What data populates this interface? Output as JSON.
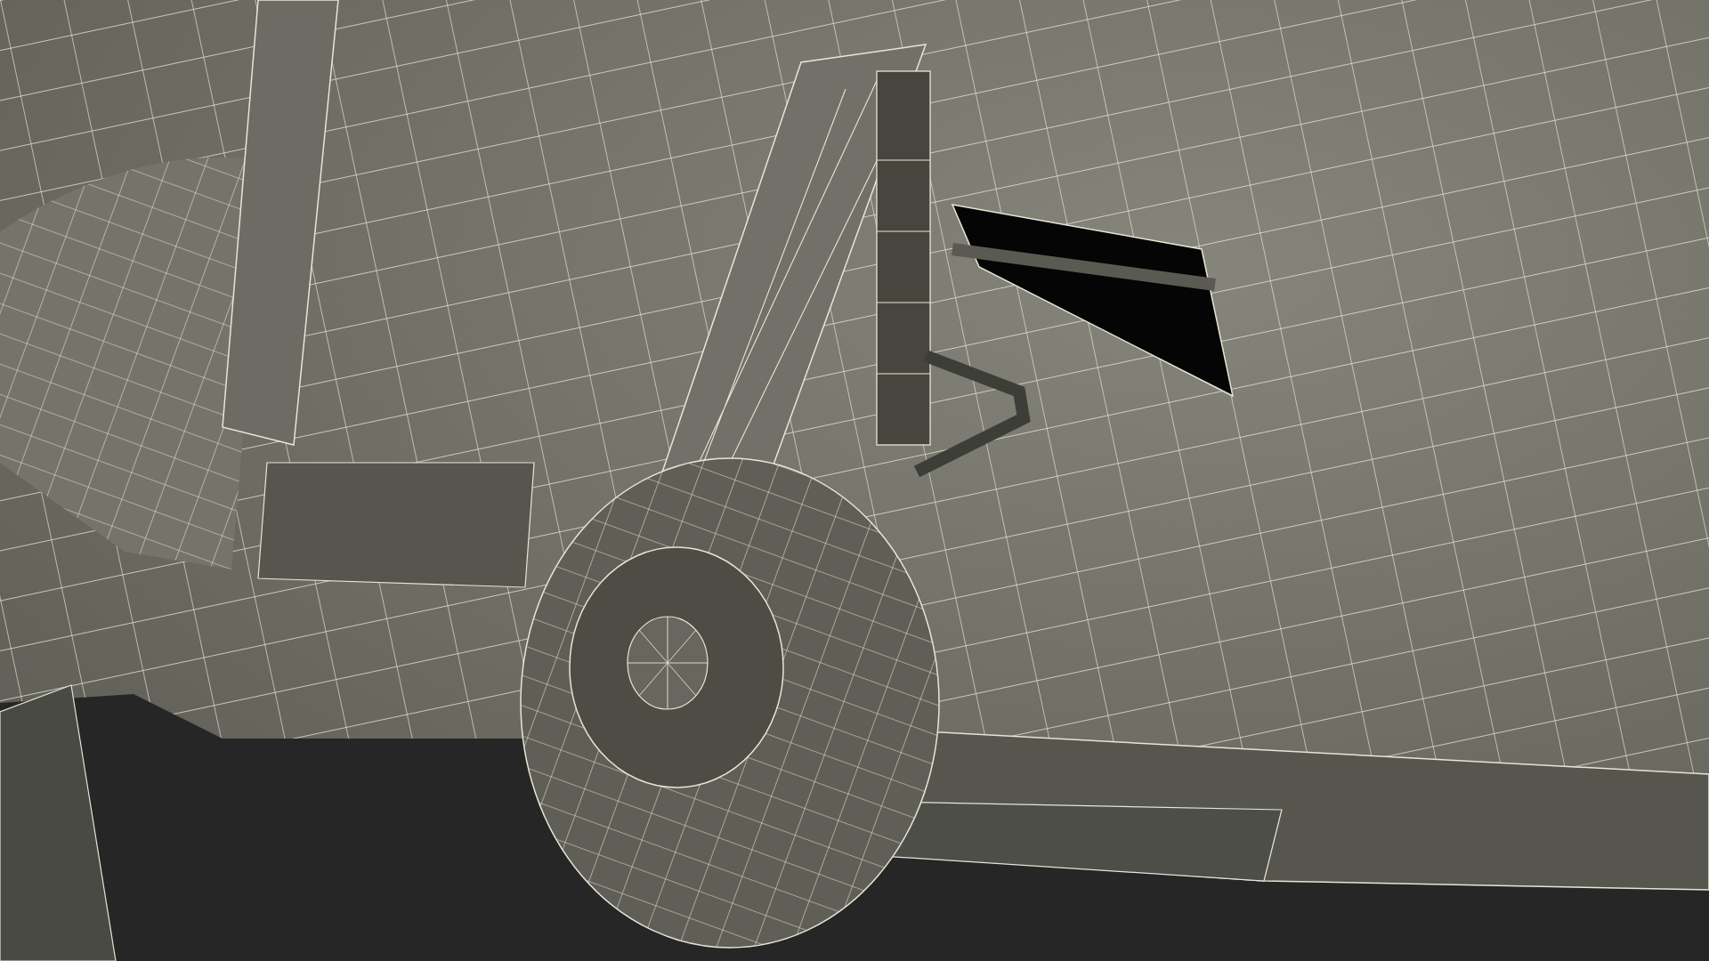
{
  "viewport": {
    "kind": "render"
  }
}
